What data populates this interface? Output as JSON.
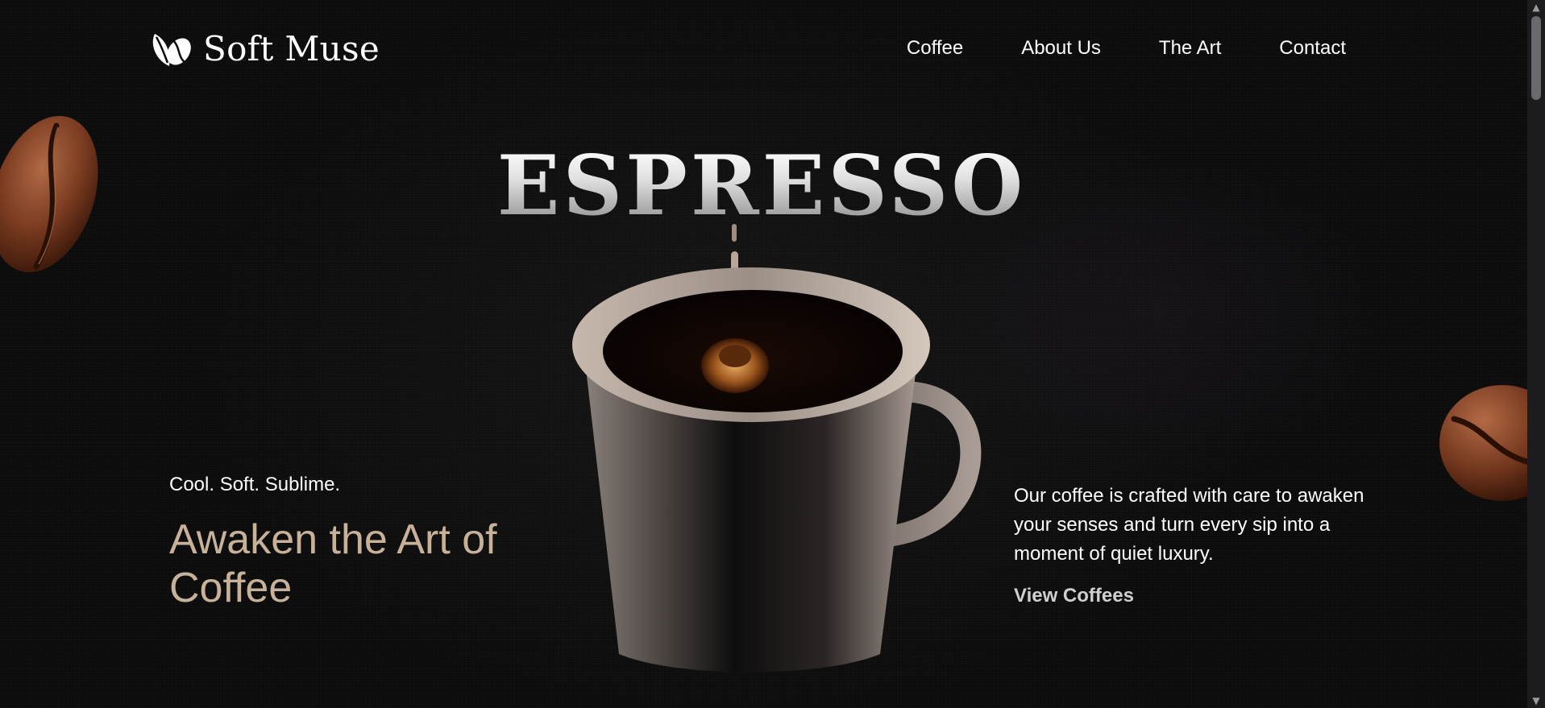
{
  "brand": {
    "name": "Soft Muse",
    "logo_icon": "coffee-bean-leaf-icon"
  },
  "nav": {
    "items": [
      {
        "label": "Coffee"
      },
      {
        "label": "About Us"
      },
      {
        "label": "The Art"
      },
      {
        "label": "Contact"
      }
    ]
  },
  "hero": {
    "title": "ESPRESSO",
    "tagline": "Cool. Soft. Sublime.",
    "headline": "Awaken the Art of Coffee",
    "description": "Our coffee is crafted with care to awaken your senses and turn every sip into a moment of quiet luxury.",
    "cta_label": "View Coffees"
  },
  "colors": {
    "background": "#0b0b0b",
    "headline_accent": "#c7b299",
    "text": "#ffffff",
    "cta": "#cfcfcf"
  }
}
